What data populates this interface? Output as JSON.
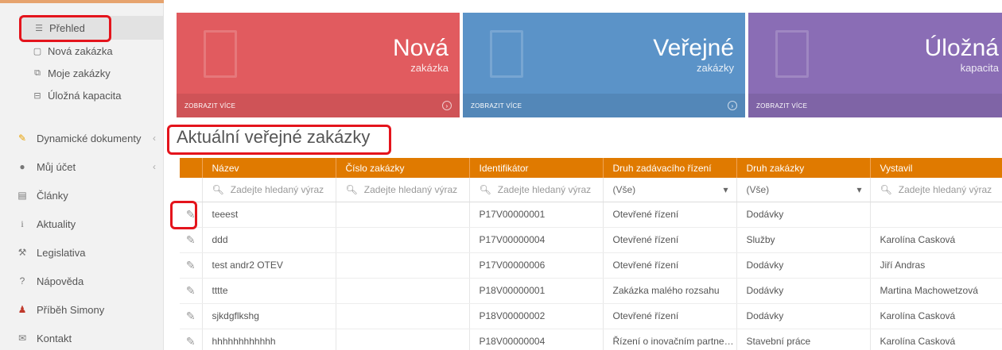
{
  "sidebar": {
    "sub_items": [
      {
        "label": "Přehled",
        "icon": "list-icon"
      },
      {
        "label": "Nová zakázka",
        "icon": "document-icon"
      },
      {
        "label": "Moje zakázky",
        "icon": "copy-icon"
      },
      {
        "label": "Úložná kapacita",
        "icon": "storage-icon"
      }
    ],
    "items": [
      {
        "label": "Dynamické dokumenty",
        "icon": "edit-icon",
        "chevron": "‹"
      },
      {
        "label": "Můj účet",
        "icon": "user-icon",
        "chevron": "‹"
      },
      {
        "label": "Články",
        "icon": "news-icon"
      },
      {
        "label": "Aktuality",
        "icon": "info-icon"
      },
      {
        "label": "Legislativa",
        "icon": "gavel-icon"
      },
      {
        "label": "Nápověda",
        "icon": "help-icon"
      },
      {
        "label": "Příběh Simony",
        "icon": "people-icon"
      },
      {
        "label": "Kontakt",
        "icon": "mail-icon"
      }
    ]
  },
  "tiles": [
    {
      "title": "Nová",
      "subtitle": "zakázka",
      "footer": "ZOBRAZIT VÍCE",
      "color": "#e15b5f"
    },
    {
      "title": "Veřejné",
      "subtitle": "zakázky",
      "footer": "ZOBRAZIT VÍCE",
      "color": "#5b93c8"
    },
    {
      "title": "Úložná",
      "subtitle": "kapacita",
      "footer": "ZOBRAZIT VÍCE",
      "color": "#8a6db5"
    }
  ],
  "section_title": "Aktuální veřejné zakázky",
  "table": {
    "columns": [
      "Název",
      "Číslo zakázky",
      "Identifikátor",
      "Druh zadávacího řízení",
      "Druh zakázky",
      "Vystavil"
    ],
    "filters": {
      "search_placeholder": "Zadejte hledaný výraz",
      "select_all": "(Vše)"
    },
    "rows": [
      [
        "teeest",
        "",
        "P17V00000001",
        "Otevřené řízení",
        "Dodávky",
        ""
      ],
      [
        "ddd",
        "",
        "P17V00000004",
        "Otevřené řízení",
        "Služby",
        "Karolína Casková"
      ],
      [
        "test andr2 OTEV",
        "",
        "P17V00000006",
        "Otevřené řízení",
        "Dodávky",
        "Jiří Andras"
      ],
      [
        "tttte",
        "",
        "P18V00000001",
        "Zakázka malého rozsahu",
        "Dodávky",
        "Martina Machowetzová"
      ],
      [
        "sjkdgflkshg",
        "",
        "P18V00000002",
        "Otevřené řízení",
        "Dodávky",
        "Karolína Casková"
      ],
      [
        "hhhhhhhhhhhh",
        "",
        "P18V00000004",
        "Řízení o inovačním partners...",
        "Stavební práce",
        "Karolína Casková"
      ]
    ]
  }
}
